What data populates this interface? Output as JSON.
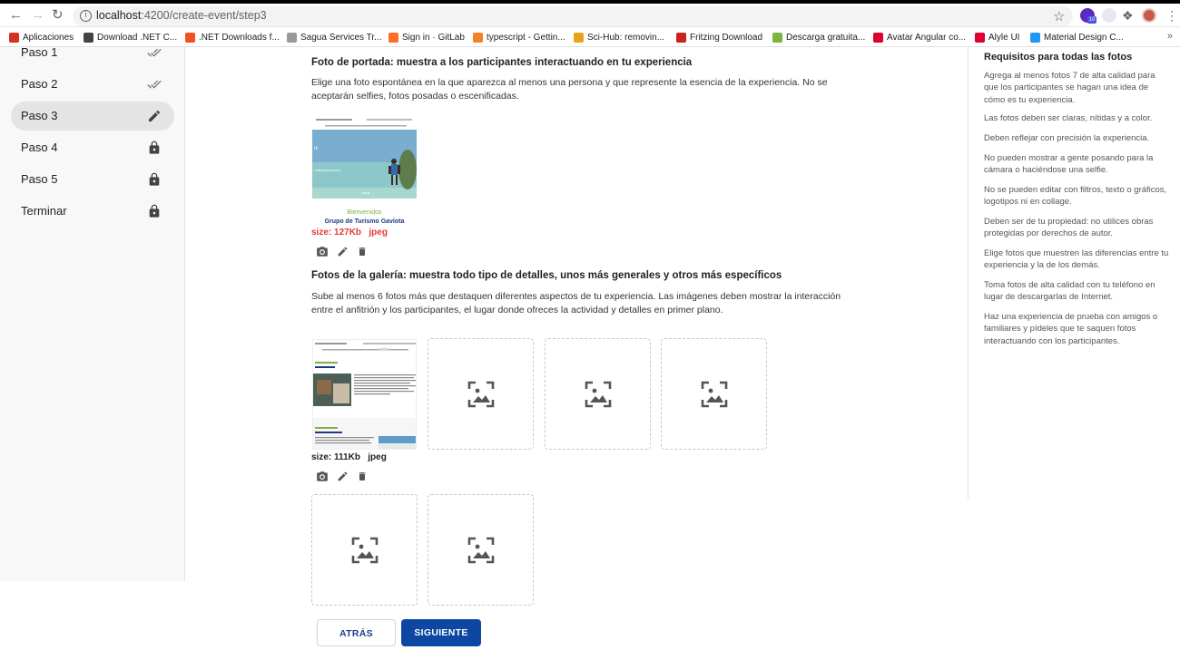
{
  "browser": {
    "url_host": "localhost",
    "url_path": ":4200/create-event/step3",
    "bookmarks": [
      {
        "label": "Aplicaciones",
        "color": "#d93025"
      },
      {
        "label": "Download .NET C...",
        "color": "#444444"
      },
      {
        "label": ".NET Downloads f...",
        "color": "#f25022"
      },
      {
        "label": "Sagua Services Tr...",
        "color": "#999999"
      },
      {
        "label": "Sign in · GitLab",
        "color": "#fc6d26"
      },
      {
        "label": "typescript - Gettin...",
        "color": "#f48024"
      },
      {
        "label": "Sci-Hub: removin...",
        "color": "#e8a317"
      },
      {
        "label": "Fritzing Download",
        "color": "#c9241c"
      },
      {
        "label": "Descarga gratuita...",
        "color": "#7cb342"
      },
      {
        "label": "Avatar Angular co...",
        "color": "#dd0031"
      },
      {
        "label": "Alyle UI",
        "color": "#dd0031"
      },
      {
        "label": "Material Design C...",
        "color": "#2196f3"
      }
    ],
    "bookmarks_more": "»",
    "extension_badge": "10"
  },
  "sidebar": {
    "steps": [
      {
        "label": "Paso 1",
        "icon": "done-all-icon"
      },
      {
        "label": "Paso 2",
        "icon": "done-all-icon"
      },
      {
        "label": "Paso 3",
        "icon": "edit-icon",
        "active": true
      },
      {
        "label": "Paso 4",
        "icon": "lock-icon"
      },
      {
        "label": "Paso 5",
        "icon": "lock-icon"
      },
      {
        "label": "Terminar",
        "icon": "lock-icon"
      }
    ]
  },
  "cover": {
    "title": "Foto de portada: muestra a los participantes interactuando en tu experiencia",
    "description": "Elige una foto espontánea en la que aparezca al menos una persona y que represente la esencia de la experiencia. No se aceptarán selfies, fotos posadas o escenificadas.",
    "image_caption_1": "Bienvenidos",
    "image_caption_2": "Grupo de Turismo Gaviota",
    "size": "size: 127Kb",
    "format": "jpeg"
  },
  "gallery": {
    "title": "Fotos de la galería: muestra todo tipo de detalles, unos más generales y otros más específicos",
    "description": "Sube al menos 6 fotos más que destaquen diferentes aspectos de tu experiencia. Las imágenes deben mostrar la interacción entre el anfitrión y los participantes, el lugar donde ofreces la actividad y detalles en primer plano.",
    "size": "size: 111Kb",
    "format": "jpeg"
  },
  "buttons": {
    "back": "ATRÁS",
    "next": "SIGUIENTE"
  },
  "requirements": {
    "title": "Requisitos para todas las fotos",
    "items": [
      "Agrega al menos fotos 7 de alta calidad para que los participantes se hagan una idea de cómo es tu experiencia.",
      "Las fotos deben ser claras, nítidas y a color.",
      "Deben reflejar con precisión la experiencia.",
      "No pueden mostrar a gente posando para la cámara o haciéndose una selfie.",
      "No se pueden editar con filtros, texto o gráficos, logotipos ni en collage.",
      "Deben ser de tu propiedad: no utilices obras protegidas por derechos de autor.",
      "Elige fotos que muestren las diferencias entre tu experiencia y la de los demás.",
      "Toma fotos de alta calidad con tu teléfono en lugar de descargarlas de Internet.",
      "Haz una experiencia de prueba con amigos o familiares y pídeles que te saquen fotos interactuando con los participantes."
    ]
  },
  "colors": {
    "primary": "#0d47a1",
    "error": "#e53935",
    "active_step": "#e4e4e4"
  }
}
